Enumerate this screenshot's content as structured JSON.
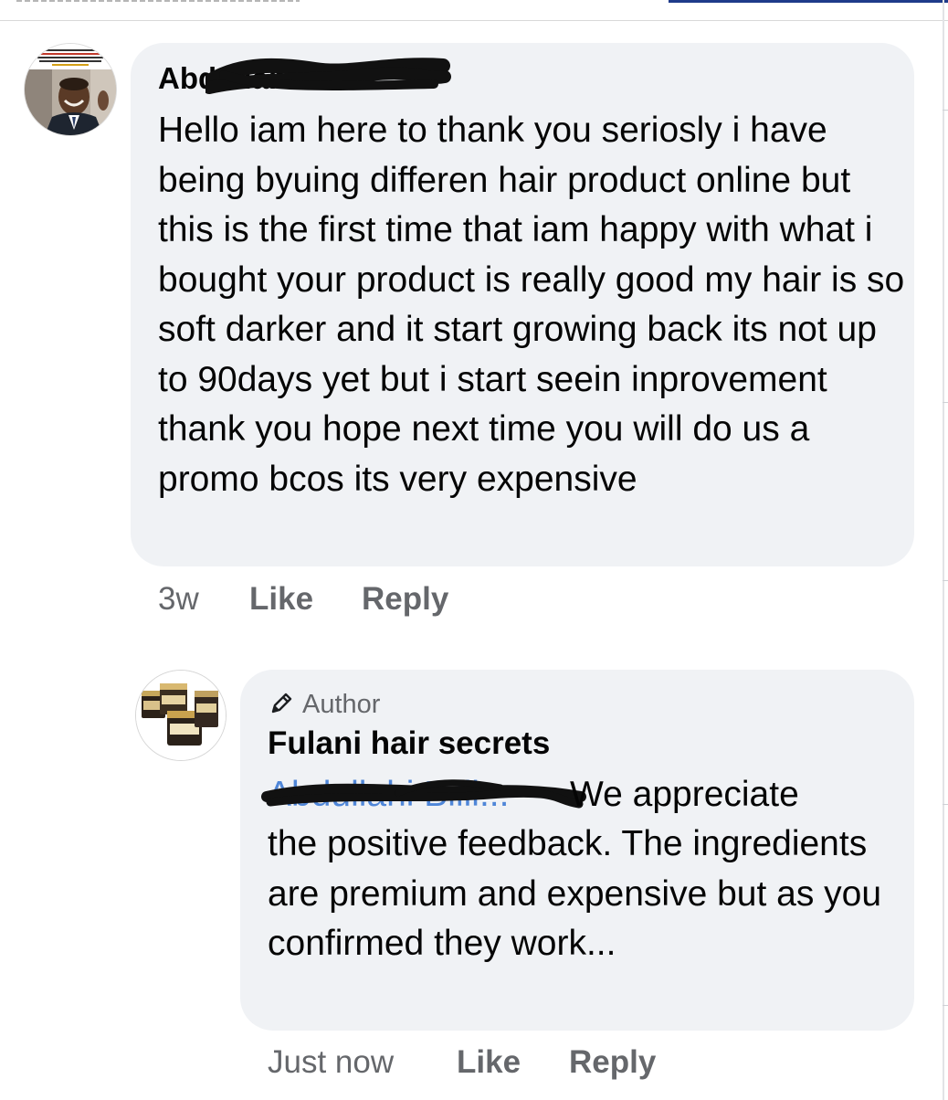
{
  "comment": {
    "author_name": "Abdullahi B",
    "text": "Hello iam here to thank you seriosly i have being byuing differen hair product online but this is the first time that iam happy with what i bought your product is really good my hair is so soft darker and it start growing back its not up to 90days yet but i start seein inprovement thank you hope next time you will do us a promo bcos its very expensive",
    "time": "3w",
    "like_label": "Like",
    "reply_label": "Reply"
  },
  "reply": {
    "badge_label": "Author",
    "author_name": "Fulani hair secrets",
    "mention": "Abdullahi Billi...",
    "text_first": "We appreciate",
    "text": "the positive feedback. The ingredients are premium and expensive but as you confirmed they work...",
    "time": "Just now",
    "like_label": "Like",
    "reply_label": "Reply"
  },
  "icons": {
    "author_badge": "pencil-icon"
  },
  "colors": {
    "bubble": "#f0f2f5",
    "secondary_text": "#65676b",
    "mention": "#4f86d8",
    "redaction": "#111111"
  }
}
